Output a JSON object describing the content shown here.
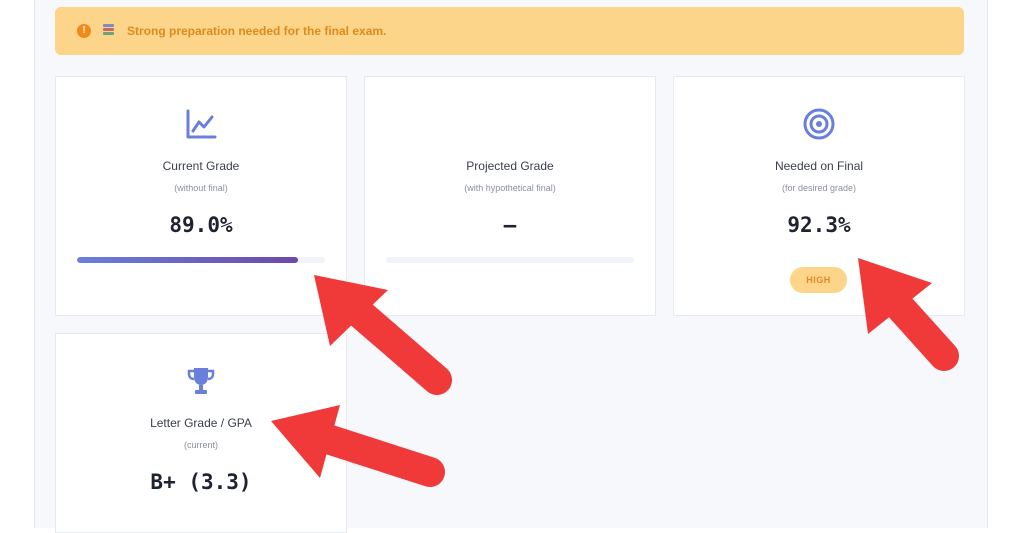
{
  "alert": {
    "message": "Strong preparation needed for the final exam.",
    "icons": [
      "warning-icon",
      "books-icon"
    ],
    "colors": {
      "background": "#fcd58a",
      "text": "#e08a1c",
      "warning": "#f18a1a"
    }
  },
  "cards": {
    "current": {
      "title": "Current Grade",
      "subtitle": "(without final)",
      "value": "89.0%",
      "progress": 0.89,
      "icon": "chart-line-icon"
    },
    "projected": {
      "title": "Projected Grade",
      "subtitle": "(with hypothetical final)",
      "value": "–",
      "progress": 0
    },
    "needed": {
      "title": "Needed on Final",
      "subtitle": "(for desired grade)",
      "value": "92.3%",
      "badge": "HIGH",
      "icon": "target-icon"
    },
    "letter": {
      "title": "Letter Grade / GPA",
      "subtitle": "(current)",
      "value": "B+ (3.3)",
      "icon": "trophy-icon"
    }
  },
  "colors": {
    "accent": "#6a7fdb",
    "gradient_end": "#6c4aa6",
    "annotation_arrow": "#f03a3a"
  }
}
